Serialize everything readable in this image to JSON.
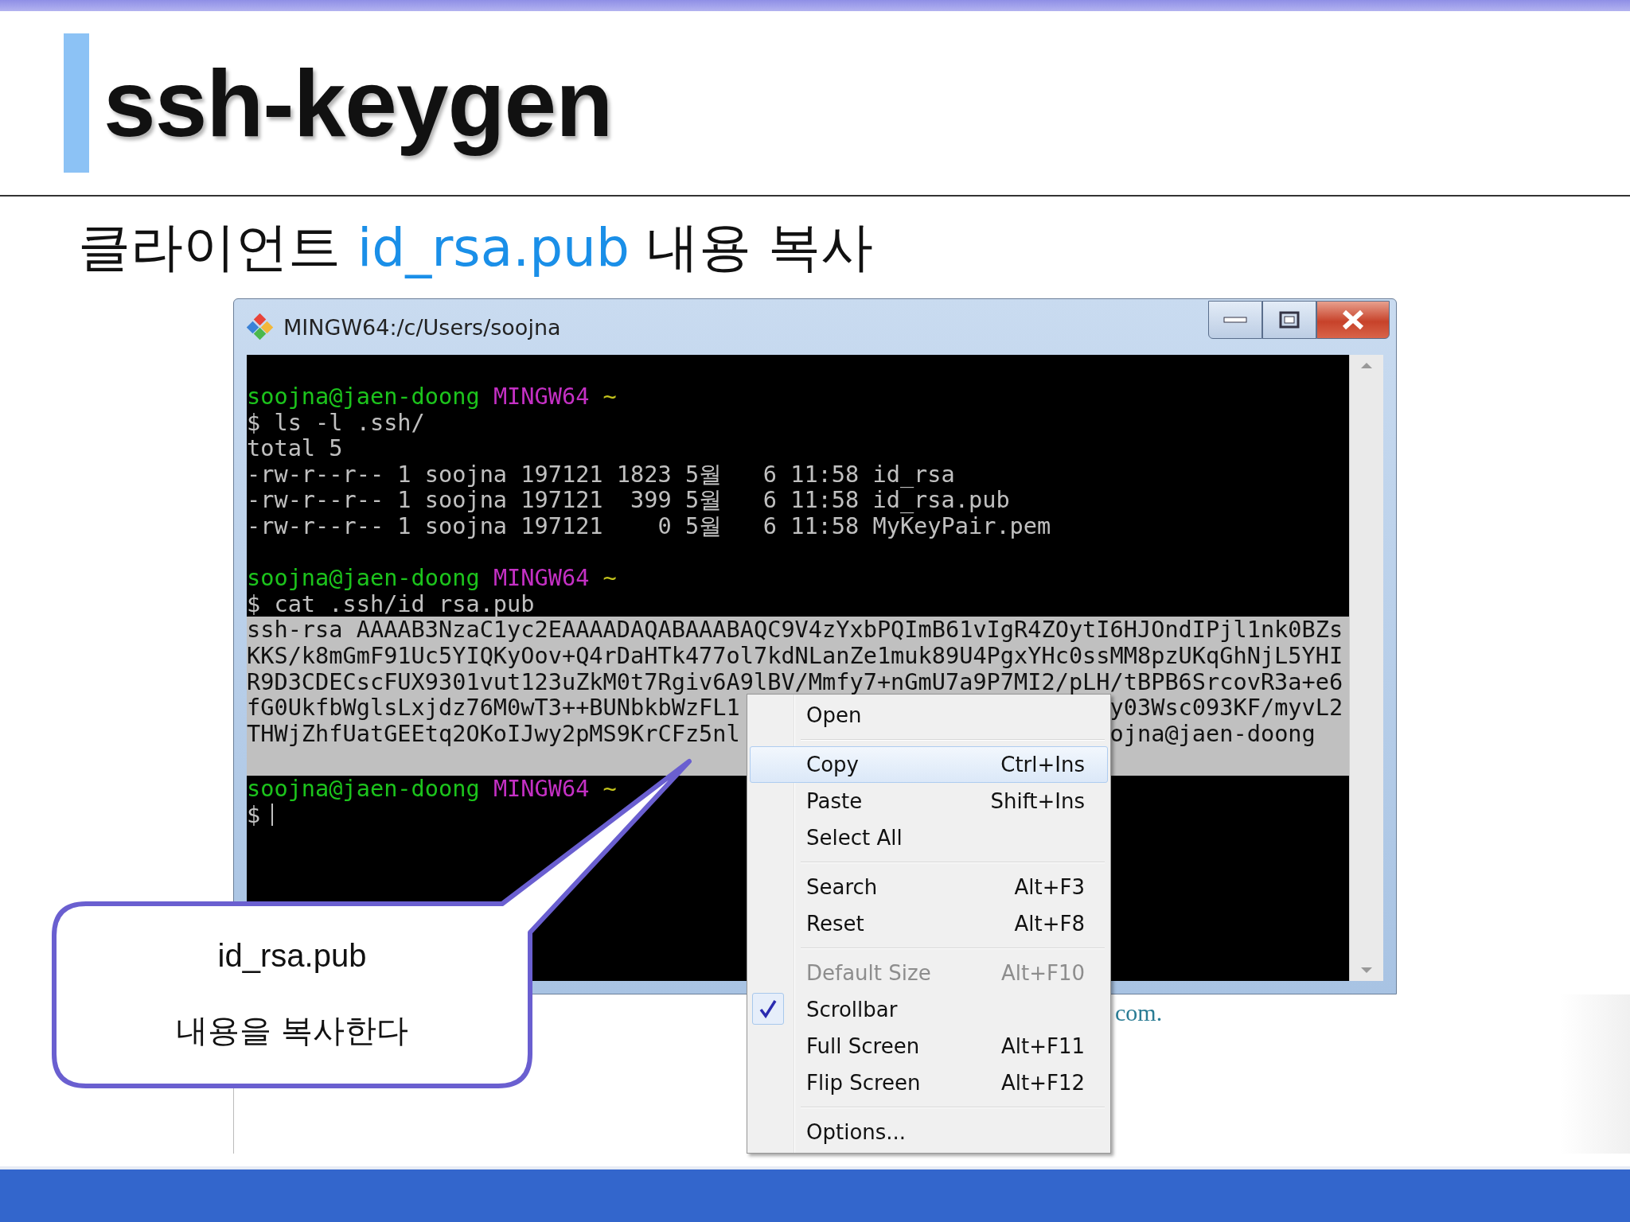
{
  "slide_title": "ssh-keygen",
  "subtitle": [
    {
      "text": "클라이언트 ",
      "highlight": false
    },
    {
      "text": "id_rsa.pub",
      "highlight": true
    },
    {
      "text": " 내용 복사",
      "highlight": false
    }
  ],
  "window": {
    "title": "MINGW64:/c/Users/soojna"
  },
  "terminal": {
    "lines": [
      {
        "kind": "prompt",
        "user": "soojna@jaen-doong",
        "shell": "MINGW64",
        "dir": "~",
        "selected": false
      },
      {
        "kind": "text",
        "text": "$ ls -l .ssh/",
        "selected": false
      },
      {
        "kind": "text",
        "text": "total 5",
        "selected": false
      },
      {
        "kind": "text",
        "text": "-rw-r--r-- 1 soojna 197121 1823 5월   6 11:58 id_rsa",
        "selected": false
      },
      {
        "kind": "text",
        "text": "-rw-r--r-- 1 soojna 197121  399 5월   6 11:58 id_rsa.pub",
        "selected": false
      },
      {
        "kind": "text",
        "text": "-rw-r--r-- 1 soojna 197121    0 5월   6 11:58 MyKeyPair.pem",
        "selected": false
      },
      {
        "kind": "blank",
        "selected": false
      },
      {
        "kind": "prompt",
        "user": "soojna@jaen-doong",
        "shell": "MINGW64",
        "dir": "~",
        "selected": false
      },
      {
        "kind": "text",
        "text": "$ cat .ssh/id_rsa.pub",
        "selected": false
      },
      {
        "kind": "text",
        "text": "ssh-rsa AAAAB3NzaC1yc2EAAAADAQABAAABAQC9V4zYxbPQImB61vIgR4ZOytI6HJOndIPjl1nk0BZs",
        "selected": true
      },
      {
        "kind": "text",
        "text": "KKS/k8mGmF91Uc5YIQKyOov+Q4rDaHTk477ol7kdNLanZe1muk89U4PgxYHc0ssMM8pzUKqGhNjL5YHI",
        "selected": true
      },
      {
        "kind": "text",
        "text": "R9D3CDECscFUX9301vut123uZkM0t7Rgiv6A9lBV/Mmfy7+nGmU7a9P7MI2/pLH/tBPB6SrcovR3a+e6",
        "selected": true
      },
      {
        "kind": "split",
        "left": "fG0UkfbWglsLxjdz76M0wT3++BUNbkbWzFL1",
        "right": "y03Wsc093KF/myvL2",
        "selected": true
      },
      {
        "kind": "split",
        "left": "THWjZhfUatGEEtq2OKoIJwy2pMS9KrCFz5nl",
        "right": "ojna@jaen-doong",
        "selected": true
      },
      {
        "kind": "blank",
        "selected": true
      },
      {
        "kind": "prompt",
        "user": "soojna@jaen-doong",
        "shell": "MINGW64",
        "dir": "~",
        "selected": false
      },
      {
        "kind": "text",
        "text": "$",
        "cursor": true,
        "selected": false
      }
    ]
  },
  "context_menu": {
    "groups": [
      [
        {
          "label": "Open",
          "selected": false,
          "disabled": false,
          "checked": false
        }
      ],
      [
        {
          "label": "Copy",
          "shortcut": "Ctrl+Ins",
          "selected": true,
          "disabled": false,
          "checked": false
        },
        {
          "label": "Paste",
          "shortcut": "Shift+Ins",
          "selected": false,
          "disabled": false,
          "checked": false
        },
        {
          "label": "Select All",
          "selected": false,
          "disabled": false,
          "checked": false
        }
      ],
      [
        {
          "label": "Search",
          "shortcut": "Alt+F3",
          "selected": false,
          "disabled": false,
          "checked": false
        },
        {
          "label": "Reset",
          "shortcut": "Alt+F8",
          "selected": false,
          "disabled": false,
          "checked": false
        }
      ],
      [
        {
          "label": "Default Size",
          "shortcut": "Alt+F10",
          "selected": false,
          "disabled": true,
          "checked": false
        },
        {
          "label": "Scrollbar",
          "selected": false,
          "disabled": false,
          "checked": true
        },
        {
          "label": "Full Screen",
          "shortcut": "Alt+F11",
          "selected": false,
          "disabled": false,
          "checked": false
        },
        {
          "label": "Flip Screen",
          "shortcut": "Alt+F12",
          "selected": false,
          "disabled": false,
          "checked": false
        }
      ],
      [
        {
          "label": "Options...",
          "selected": false,
          "disabled": false,
          "checked": false
        }
      ]
    ]
  },
  "background_text": "com.",
  "callout": {
    "lines": [
      "id_rsa.pub",
      "내용을 복사한다"
    ]
  }
}
